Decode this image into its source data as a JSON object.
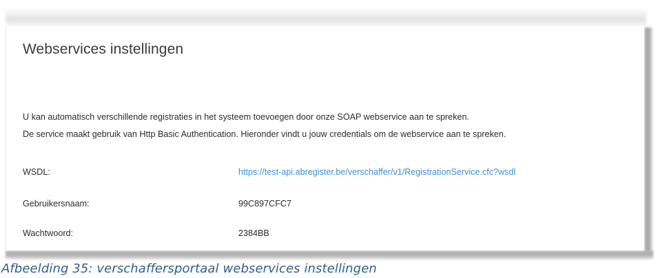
{
  "card": {
    "title": "Webservices instellingen",
    "intro_line1": "U kan automatisch verschillende registraties in het systeem toevoegen door onze SOAP webservice aan te spreken.",
    "intro_line2": "De service maakt gebruik van Http Basic Authentication. Hieronder vindt u jouw credentials om de webservice aan te spreken.",
    "fields": [
      {
        "label": "WSDL:",
        "value": "https://test-api.abregister.be/verschaffer/v1/RegistrationService.cfc?wsdl"
      },
      {
        "label": "Gebruikersnaam:",
        "value": "99C897CFC7"
      },
      {
        "label": "Wachtwoord:",
        "value": "2384BB"
      }
    ]
  },
  "caption": "Afbeelding 35: verschaffersportaal webservices instellingen",
  "colors": {
    "link": "#3d8fd1",
    "caption": "#2f5f8f",
    "text": "#2c2c2c"
  }
}
